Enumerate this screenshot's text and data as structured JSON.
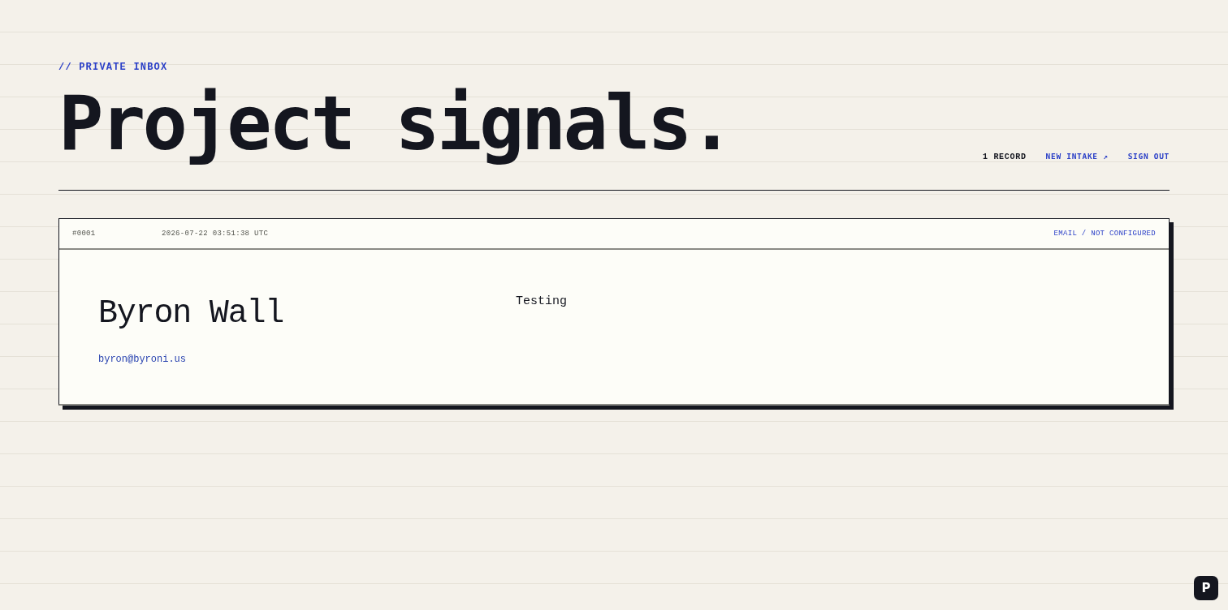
{
  "header": {
    "eyebrow": "// PRIVATE INBOX",
    "title": "Project signals.",
    "record_count": "1 RECORD",
    "links": [
      {
        "label": "NEW INTAKE ↗"
      },
      {
        "label": "SIGN OUT"
      }
    ]
  },
  "records": [
    {
      "number": "#0001",
      "timestamp": "2026-07-22 03:51:38 UTC",
      "channel_status": "EMAIL / NOT CONFIGURED",
      "name": "Byron Wall",
      "email": "byron@byroni.us",
      "message": "Testing"
    }
  ],
  "floating_badge": {
    "label": "P"
  }
}
